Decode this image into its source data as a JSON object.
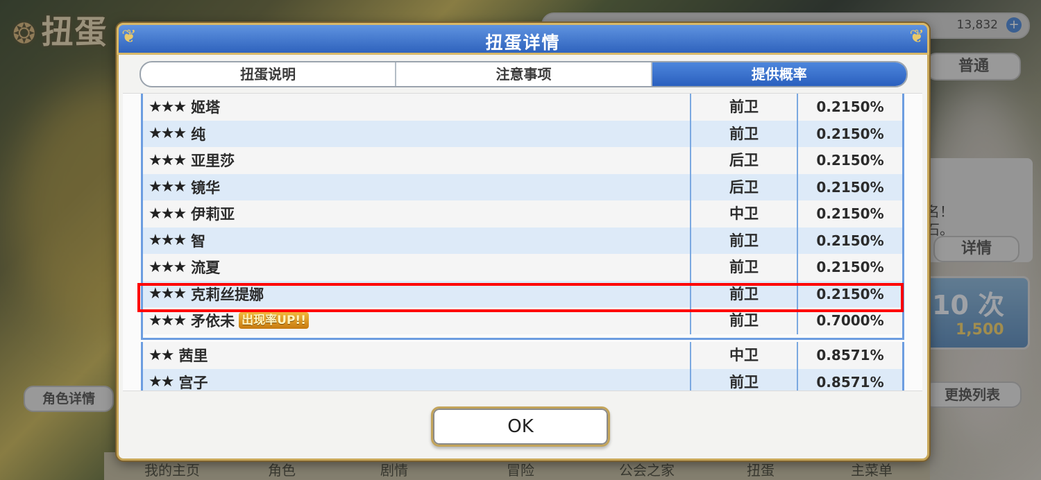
{
  "background": {
    "screen_title": "扭蛋",
    "currency_value": "13,832",
    "right_tab_label": "普通",
    "right_text_line1": "名！",
    "right_text_line2": "石。",
    "details_button": "详情",
    "ten_pull_label": "10 次",
    "ten_pull_cost": "1,500",
    "char_details_button": "角色详情",
    "switch_list_button": "更换列表",
    "nav": [
      "我的主页",
      "角色",
      "剧情",
      "冒险",
      "公会之家",
      "扭蛋",
      "主菜单"
    ]
  },
  "dialog": {
    "title": "扭蛋详情",
    "tabs": [
      {
        "label": "扭蛋说明",
        "active": false
      },
      {
        "label": "注意事项",
        "active": false
      },
      {
        "label": "提供概率",
        "active": true
      }
    ],
    "rows_3star": [
      {
        "stars": "★★★",
        "name": "姬塔",
        "role": "前卫",
        "rate": "0.2150%"
      },
      {
        "stars": "★★★",
        "name": "纯",
        "role": "前卫",
        "rate": "0.2150%"
      },
      {
        "stars": "★★★",
        "name": "亚里莎",
        "role": "后卫",
        "rate": "0.2150%"
      },
      {
        "stars": "★★★",
        "name": "镜华",
        "role": "后卫",
        "rate": "0.2150%"
      },
      {
        "stars": "★★★",
        "name": "伊莉亚",
        "role": "中卫",
        "rate": "0.2150%"
      },
      {
        "stars": "★★★",
        "name": "智",
        "role": "前卫",
        "rate": "0.2150%"
      },
      {
        "stars": "★★★",
        "name": "流夏",
        "role": "前卫",
        "rate": "0.2150%"
      },
      {
        "stars": "★★★",
        "name": "克莉丝提娜",
        "role": "前卫",
        "rate": "0.2150%"
      },
      {
        "stars": "★★★",
        "name": "矛依未",
        "badge": "出现率UP!!",
        "role": "前卫",
        "rate": "0.7000%"
      }
    ],
    "rows_2star": [
      {
        "stars": "★★",
        "name": "茜里",
        "role": "中卫",
        "rate": "0.8571%"
      },
      {
        "stars": "★★",
        "name": "宫子",
        "role": "前卫",
        "rate": "0.8571%"
      }
    ],
    "ok_label": "OK"
  },
  "colors": {
    "header_blue": "#2f63bd",
    "gold_border": "#c9a85a",
    "highlight_red": "#ff0000"
  }
}
